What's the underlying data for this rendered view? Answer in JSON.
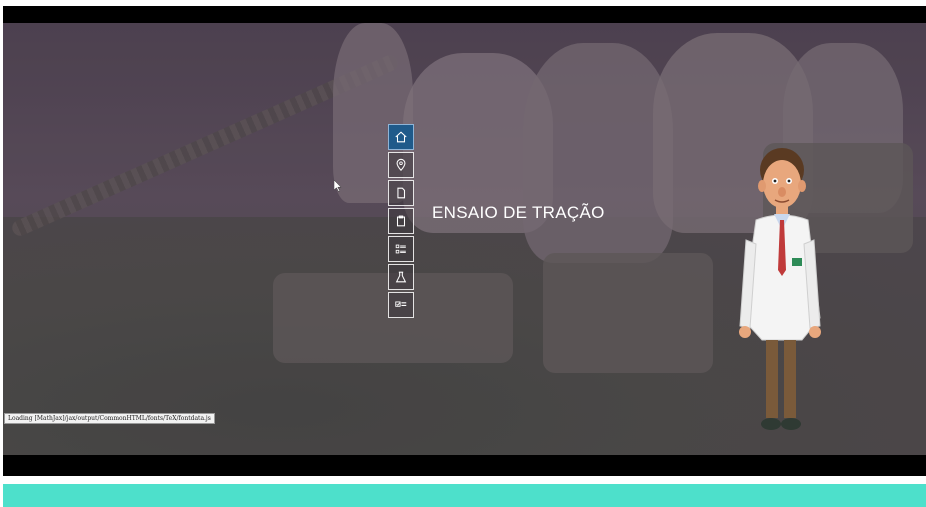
{
  "slide": {
    "title": "ENSAIO DE TRAÇÃO"
  },
  "menu": {
    "items": [
      {
        "icon": "home-icon",
        "active": true
      },
      {
        "icon": "map-pin-icon",
        "active": false
      },
      {
        "icon": "document-icon",
        "active": false
      },
      {
        "icon": "clipboard-icon",
        "active": false
      },
      {
        "icon": "list-icon",
        "active": false
      },
      {
        "icon": "flask-icon",
        "active": false
      },
      {
        "icon": "checklist-icon",
        "active": false
      }
    ]
  },
  "status_bar": {
    "text": "Loading [MathJax]/jax/output/CommonHTML/fonts/TeX/fontdata.js"
  },
  "colors": {
    "accent": "#4de0cb",
    "menu_active": "#1f5a8a",
    "background": "#000000"
  }
}
